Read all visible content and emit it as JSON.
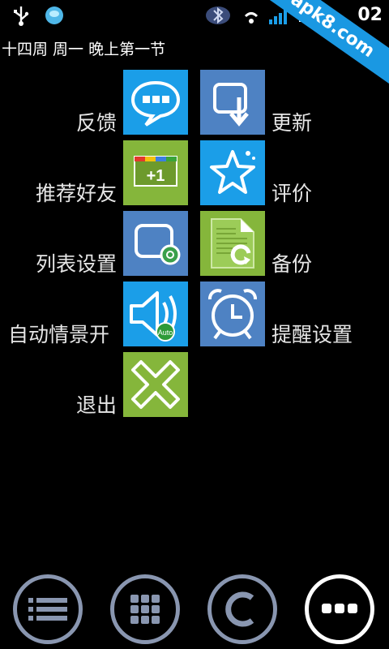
{
  "status": {
    "time": "02",
    "watermark": "apk8.com"
  },
  "subtitle": "十四周 周一 晚上第一节",
  "menu": {
    "feedback": "反馈",
    "update": "更新",
    "recommend": "推荐好友",
    "rate": "评价",
    "list_settings": "列表设置",
    "backup": "备份",
    "auto_mode": "自动情景开",
    "reminder_settings": "提醒设置",
    "exit": "退出"
  },
  "tile_text": {
    "plus_one": "+1",
    "auto": "Auto"
  },
  "colors": {
    "blue": "#1b9ee8",
    "steel": "#4e82c3",
    "green": "#85b63b"
  }
}
